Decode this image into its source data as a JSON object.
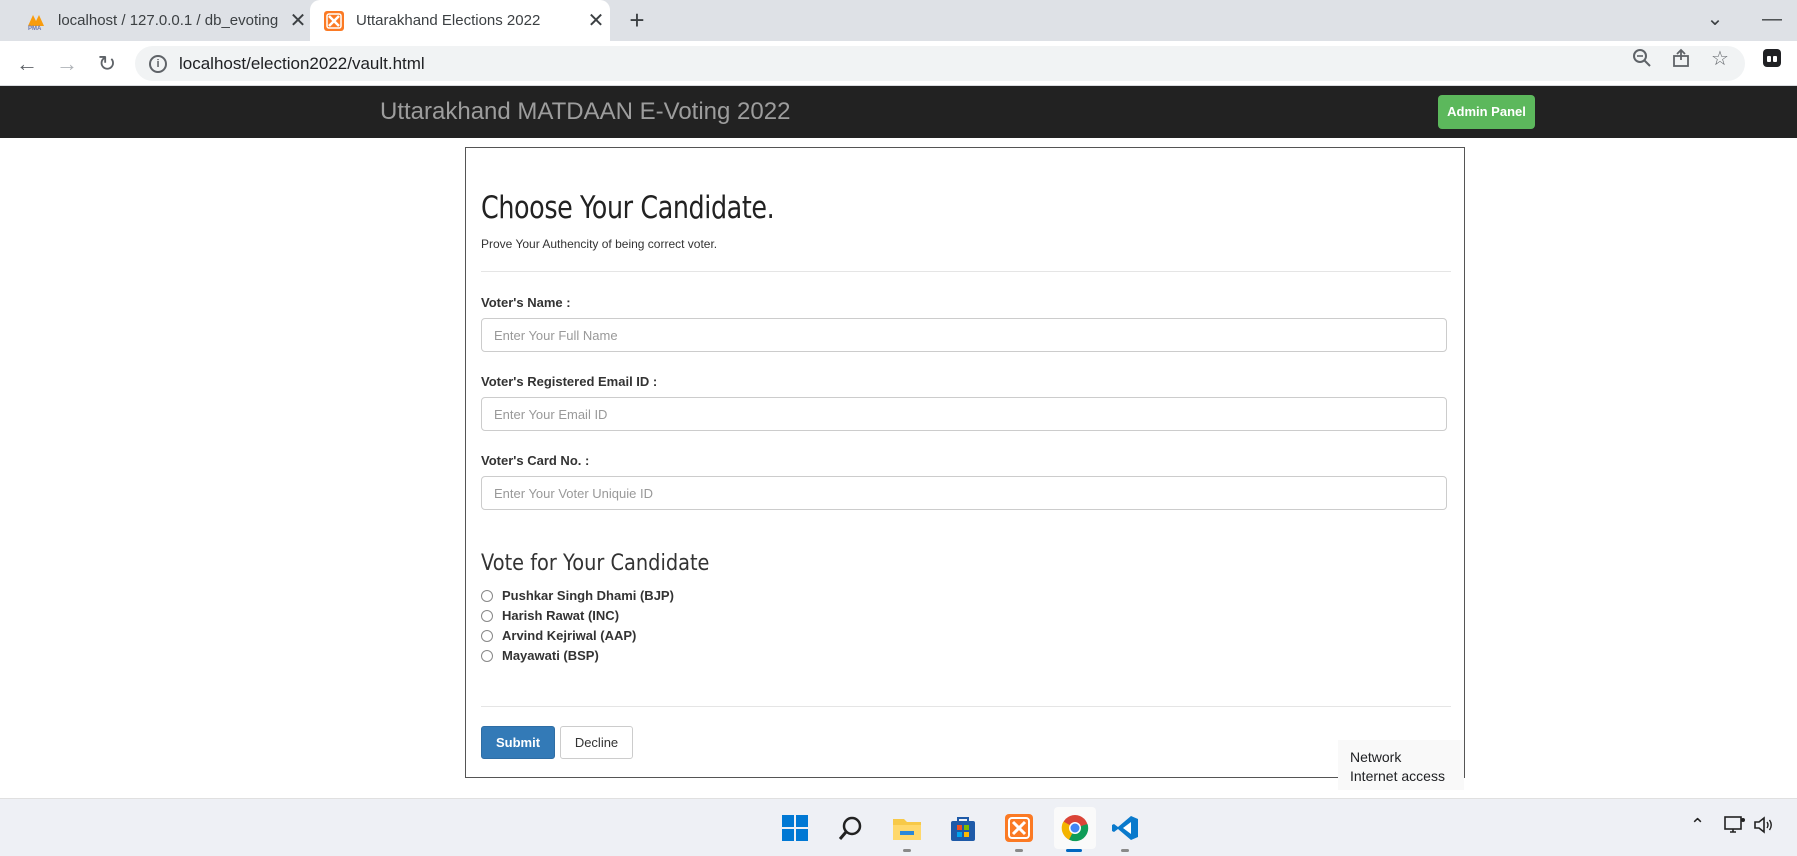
{
  "browser": {
    "tabs": [
      {
        "title": "localhost / 127.0.0.1 / db_evoting",
        "favicon": "phpmyadmin-icon",
        "active": false
      },
      {
        "title": "Uttarakhand Elections 2022",
        "favicon": "xampp-icon",
        "active": true
      }
    ],
    "url": "localhost/election2022/vault.html"
  },
  "site": {
    "brand": "Uttarakhand MATDAAN E-Voting 2022",
    "admin_button": "Admin Panel",
    "colors": {
      "navbar": "#222222",
      "admin": "#5cb85c",
      "submit": "#337ab7"
    }
  },
  "form": {
    "title": "Choose Your Candidate.",
    "subtitle": "Prove Your Authencity of being correct voter.",
    "fields": [
      {
        "label": "Voter's Name :",
        "placeholder": "Enter Your Full Name",
        "value": ""
      },
      {
        "label": "Voter's Registered Email ID :",
        "placeholder": "Enter Your Email ID",
        "value": ""
      },
      {
        "label": "Voter's Card No. :",
        "placeholder": "Enter Your Voter Uniquie ID",
        "value": ""
      }
    ],
    "vote_heading": "Vote for Your Candidate",
    "candidates": [
      {
        "label": "Pushkar Singh Dhami (BJP)",
        "selected": false
      },
      {
        "label": "Harish Rawat (INC)",
        "selected": false
      },
      {
        "label": "Arvind Kejriwal (AAP)",
        "selected": false
      },
      {
        "label": "Mayawati (BSP)",
        "selected": false
      }
    ],
    "submit_label": "Submit",
    "decline_label": "Decline"
  },
  "tooltip": {
    "line1": "Network",
    "line2": "Internet access"
  },
  "taskbar": {
    "icons": [
      "windows-start-icon",
      "search-icon",
      "file-explorer-icon",
      "microsoft-store-icon",
      "xampp-icon",
      "chrome-icon",
      "vscode-icon"
    ]
  }
}
